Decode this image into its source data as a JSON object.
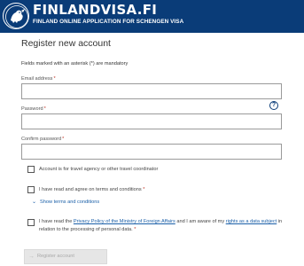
{
  "header": {
    "title": "FINLANDVISA.FI",
    "subtitle": "FINLAND ONLINE APPLICATION FOR SCHENGEN VISA",
    "logo_icon": "lion-coat-of-arms-icon",
    "background_color": "#0a3c78"
  },
  "form": {
    "title": "Register new account",
    "mandatory_note": "Fields marked with an asterisk (*) are mandatory",
    "fields": {
      "email": {
        "label": "Email address",
        "value": "",
        "placeholder": ""
      },
      "password": {
        "label": "Password",
        "value": "",
        "placeholder": ""
      },
      "confirm_password": {
        "label": "Confirm password",
        "value": "",
        "placeholder": ""
      }
    },
    "required_mark": "*",
    "password_help_icon": "question-circle-icon",
    "checkboxes": {
      "travel_agency": {
        "label": "Account is for travel agency or other travel coordinator",
        "checked": false
      },
      "terms": {
        "label": "I have read and agree on terms and conditions",
        "checked": false
      },
      "privacy": {
        "text_1": "I have read the ",
        "link_1": "Privacy Policy of the Ministry of Foreign Affairs",
        "text_2": " and I am aware of my ",
        "link_2": "rights as a data subject",
        "text_3": " in relation to the processing of personal data.",
        "checked": false
      }
    },
    "show_terms_label": "Show terms and conditions",
    "register_button": "Register account",
    "link_color": "#1a5fa8"
  }
}
